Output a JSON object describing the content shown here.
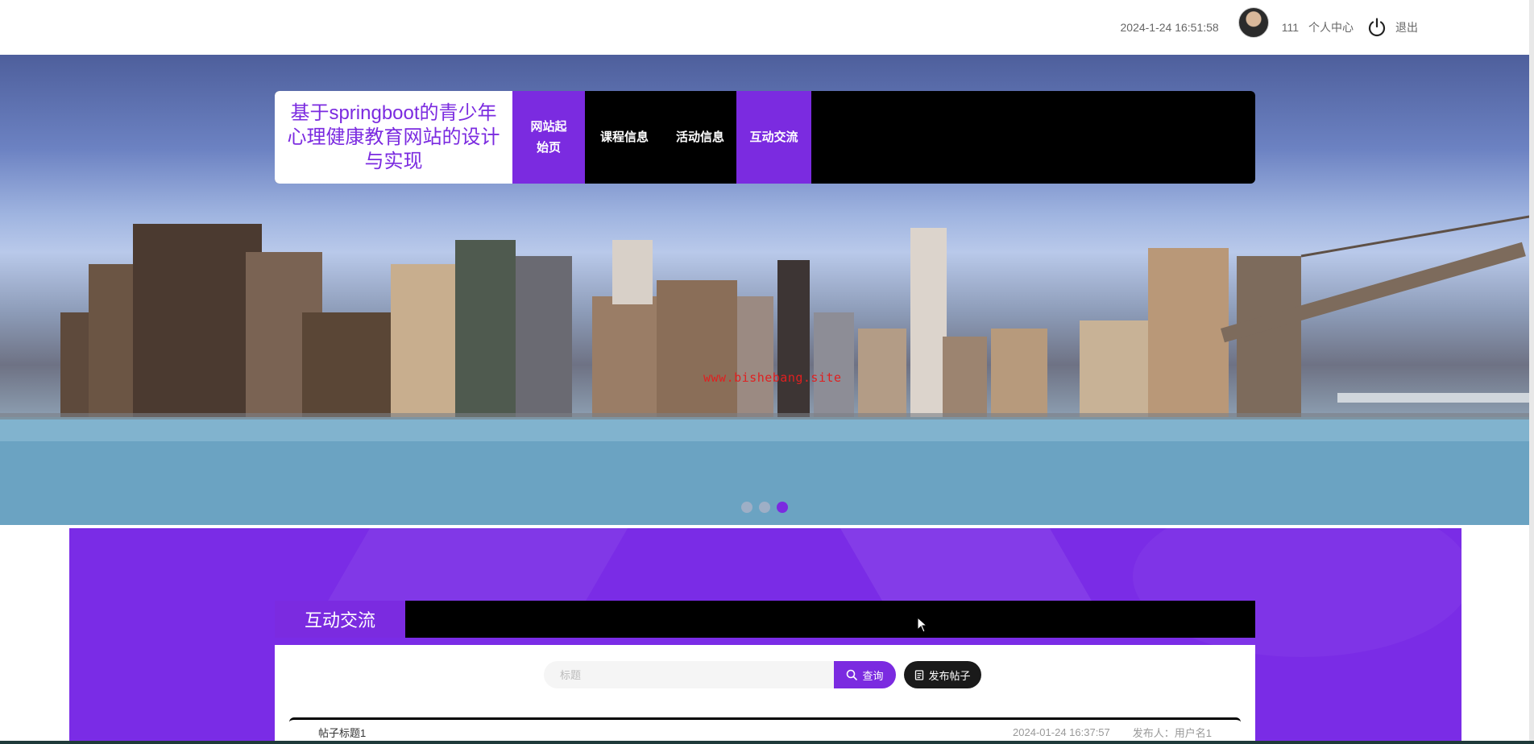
{
  "topbar": {
    "datetime": "2024-1-24 16:51:58",
    "username": "111",
    "personal_center": "个人中心",
    "logout": "退出"
  },
  "nav": {
    "brand": "基于springboot的青少年心理健康教育网站的设计与实现",
    "items": [
      {
        "label": "网站起始页",
        "active": true
      },
      {
        "label": "课程信息",
        "active": false
      },
      {
        "label": "活动信息",
        "active": false
      },
      {
        "label": "互动交流",
        "active": true
      }
    ]
  },
  "banner": {
    "watermark": "www.bishebang.site",
    "carousel_total": 3,
    "carousel_active": 3
  },
  "section": {
    "title": "互动交流",
    "search_placeholder": "标题",
    "search_value": "",
    "search_button": "查询",
    "post_button": "发布帖子"
  },
  "posts": [
    {
      "title": "帖子标题1",
      "time": "2024-01-24 16:37:57",
      "author": "发布人：用户名1"
    }
  ],
  "colors": {
    "accent": "#7b2be0",
    "nav_bg": "#000000",
    "section_bg": "#7a2ce6"
  },
  "icons": {
    "search": "search-icon",
    "post": "document-icon",
    "logout": "power-icon"
  }
}
